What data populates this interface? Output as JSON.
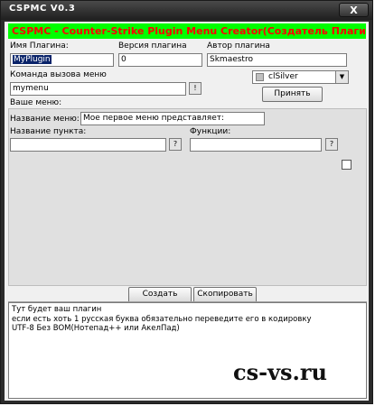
{
  "window": {
    "title": "CSPMC V0.3",
    "close_label": "X"
  },
  "banner": "CSPMC - Counter-Strike Plugin Menu Creator(Создатель Плагинов(Меню))",
  "fields": {
    "plugin_name": {
      "label": "Имя Плагина:",
      "value": "MyPlugin"
    },
    "plugin_version": {
      "label": "Версия плагина",
      "value": "0"
    },
    "plugin_author": {
      "label": "Автор плагина",
      "value": "Skmaestro"
    },
    "menu_command": {
      "label": "Команда вызова меню",
      "value": "mymenu",
      "button": "!"
    }
  },
  "color_select": {
    "value": "clSilver",
    "swatch_color": "#c0c0c0"
  },
  "apply_button": "Принять",
  "menu_section": {
    "label": "Ваше меню:",
    "menu_title_label": "Название меню:",
    "menu_title_value": "Мое первое меню представляет:",
    "item_name_label": "Название пункта:",
    "item_name_help": "?",
    "functions_label": "Функции:",
    "functions_help": "?"
  },
  "tabs": {
    "create": "Создать",
    "copy": "Скопировать"
  },
  "output_lines": [
    "Тут будет ваш плагин",
    "если есть хоть 1 русская буква обязательно переведите его в кодировку",
    "UTF-8 Без BOM(Нотепад++ или АкелПад)"
  ],
  "watermark": "cs-vs.ru"
}
